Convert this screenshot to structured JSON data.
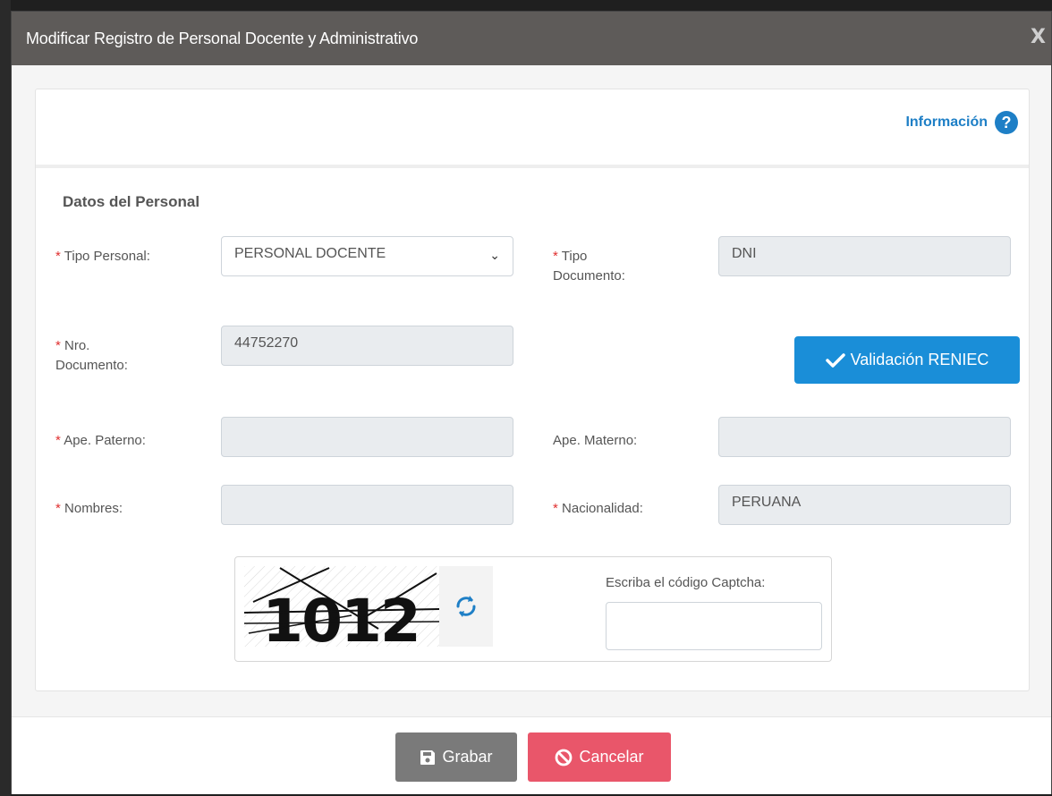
{
  "modal": {
    "title": "Modificar Registro de Personal Docente y Administrativo",
    "close_label": "X"
  },
  "info": {
    "label": "Información",
    "icon": "question-circle-icon"
  },
  "section_title": "Datos del Personal",
  "form": {
    "tipo_personal": {
      "label": "Tipo Personal:",
      "value": "PERSONAL DOCENTE"
    },
    "tipo_documento": {
      "label_line1": "Tipo",
      "label_line2": "Documento:",
      "value": "DNI"
    },
    "nro_documento": {
      "label_line1": "Nro.",
      "label_line2": "Documento:",
      "value": "44752270"
    },
    "ape_paterno": {
      "label": "Ape. Paterno:",
      "value": ""
    },
    "ape_materno": {
      "label": "Ape. Materno:",
      "value": ""
    },
    "nombres": {
      "label": "Nombres:",
      "value": ""
    },
    "nacionalidad": {
      "label": "Nacionalidad:",
      "value": "PERUANA"
    },
    "required_mark": "*"
  },
  "reniec_button": {
    "label": "Validación RENIEC",
    "icon": "check-icon"
  },
  "captcha": {
    "text": "1012",
    "label": "Escriba el código Captcha:",
    "input_value": ""
  },
  "footer": {
    "save_label": "Grabar",
    "cancel_label": "Cancelar"
  },
  "colors": {
    "header_bg": "#5e5b59",
    "primary": "#1a8ed8",
    "link": "#1e7fc6",
    "save_bg": "#7a7a7a",
    "cancel_bg": "#e9566a",
    "required": "#e03030"
  }
}
